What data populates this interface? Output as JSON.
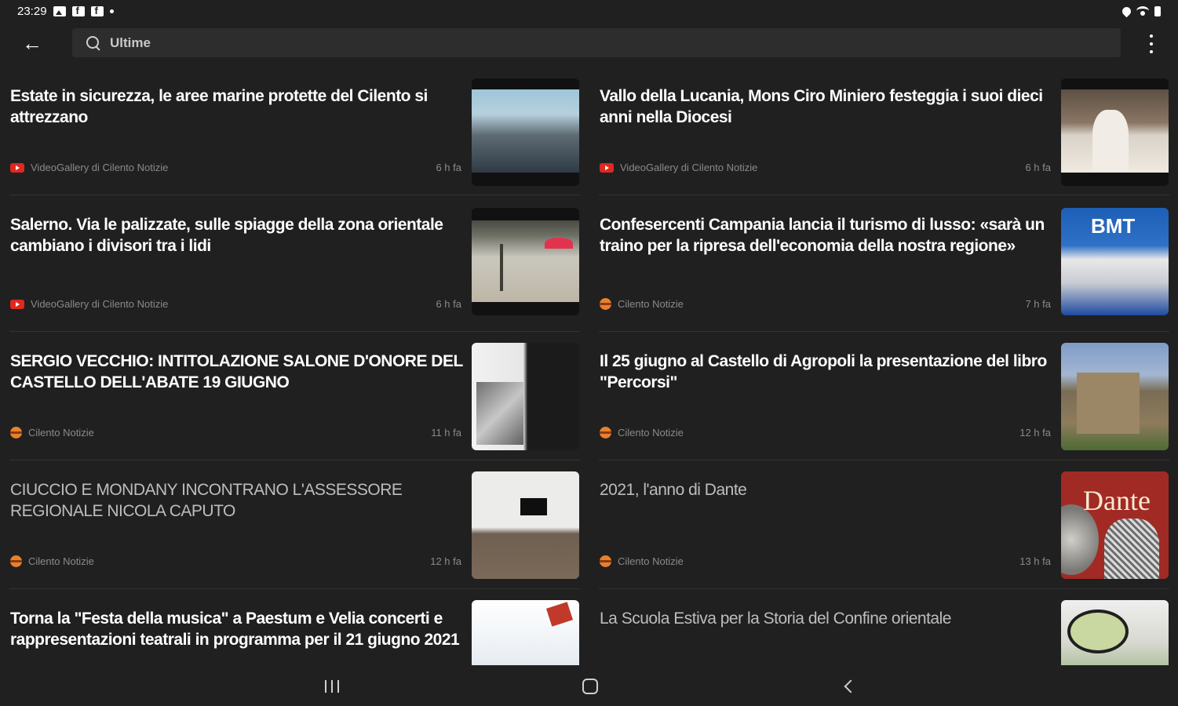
{
  "status_bar": {
    "time": "23:29"
  },
  "search": {
    "query": "Ultime"
  },
  "articles": [
    {
      "title": "Estate in sicurezza, le aree marine protette del Cilento si attrezzano",
      "source": "VideoGallery di Cilento Notizie",
      "source_icon": "youtube-icon",
      "time": "6 h fa",
      "read": false
    },
    {
      "title": "Vallo della Lucania, Mons Ciro Miniero festeggia i suoi dieci anni nella Diocesi",
      "source": "VideoGallery di Cilento Notizie",
      "source_icon": "youtube-icon",
      "time": "6 h fa",
      "read": false
    },
    {
      "title": "Salerno. Via le palizzate, sulle spiagge della zona orientale cambiano i divisori tra i lidi",
      "source": "VideoGallery di Cilento Notizie",
      "source_icon": "youtube-icon",
      "time": "6 h fa",
      "read": false
    },
    {
      "title": "Confesercenti Campania lancia il turismo di lusso: «sarà un traino per la ripresa dell'economia della nostra regione»",
      "source": "Cilento Notizie",
      "source_icon": "cilento-notizie-icon",
      "time": "7 h fa",
      "read": false
    },
    {
      "title": "SERGIO VECCHIO: INTITOLAZIONE SALONE D'ONORE DEL CASTELLO DELL'ABATE 19 GIUGNO",
      "source": "Cilento Notizie",
      "source_icon": "cilento-notizie-icon",
      "time": "11 h fa",
      "read": false
    },
    {
      "title": "Il 25 giugno al Castello di Agropoli la presentazione del libro \"Percorsi\"",
      "source": "Cilento Notizie",
      "source_icon": "cilento-notizie-icon",
      "time": "12 h fa",
      "read": false
    },
    {
      "title": "CIUCCIO E MONDANY INCONTRANO L'ASSESSORE REGIONALE NICOLA CAPUTO",
      "source": "Cilento Notizie",
      "source_icon": "cilento-notizie-icon",
      "time": "12 h fa",
      "read": true
    },
    {
      "title": "2021, l'anno di Dante",
      "source": "Cilento Notizie",
      "source_icon": "cilento-notizie-icon",
      "time": "13 h fa",
      "read": true,
      "thumb_text": "Dante"
    },
    {
      "title": "Torna la \"Festa della musica\" a Paestum e Velia concerti e rappresentazioni teatrali in programma per il 21 giugno 2021",
      "read": false
    },
    {
      "title": "La Scuola Estiva per la Storia del Confine orientale",
      "read": true
    }
  ],
  "colors": {
    "background": "#202020",
    "youtube": "#e0281f",
    "cilento_notizie": "#e8812d"
  }
}
